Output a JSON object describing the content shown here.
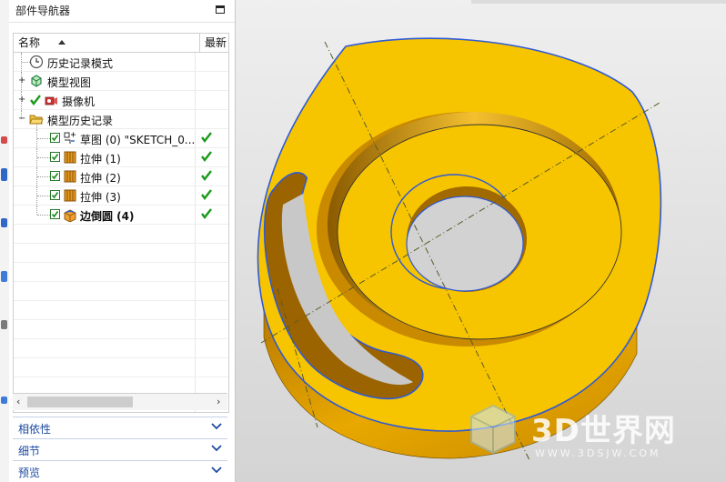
{
  "navigator": {
    "title": "部件导航器",
    "columns": {
      "name": "名称",
      "latest": "最新"
    },
    "items": [
      {
        "label": "历史记录模式",
        "icon": "clock-icon",
        "latest": false
      },
      {
        "label": "模型视图",
        "icon": "model-views-icon",
        "latest": false
      },
      {
        "label": "摄像机",
        "icon": "camera-icon",
        "latest": false
      },
      {
        "label": "模型历史记录",
        "icon": "folder-open-icon",
        "latest": false
      },
      {
        "label": "草图 (0) \"SKETCH_0...",
        "icon": "sketch-icon",
        "latest": true
      },
      {
        "label": "拉伸 (1)",
        "icon": "extrude-icon",
        "latest": true
      },
      {
        "label": "拉伸 (2)",
        "icon": "extrude-icon",
        "latest": true
      },
      {
        "label": "拉伸 (3)",
        "icon": "extrude-icon",
        "latest": true
      },
      {
        "label": "边倒圆 (4)",
        "icon": "edge-blend-icon",
        "latest": true
      }
    ],
    "sections": [
      {
        "label": "相依性"
      },
      {
        "label": "细节"
      },
      {
        "label": "预览"
      }
    ]
  },
  "watermark": {
    "brand": "3D世界网",
    "url": "WWW.3DSJW.COM"
  },
  "colors": {
    "part_face": "#f7c400",
    "part_side": "#e0a000",
    "edge_blue": "#2e5ad6",
    "check_green": "#1a9a1a",
    "section_text": "#1b4aa0"
  }
}
